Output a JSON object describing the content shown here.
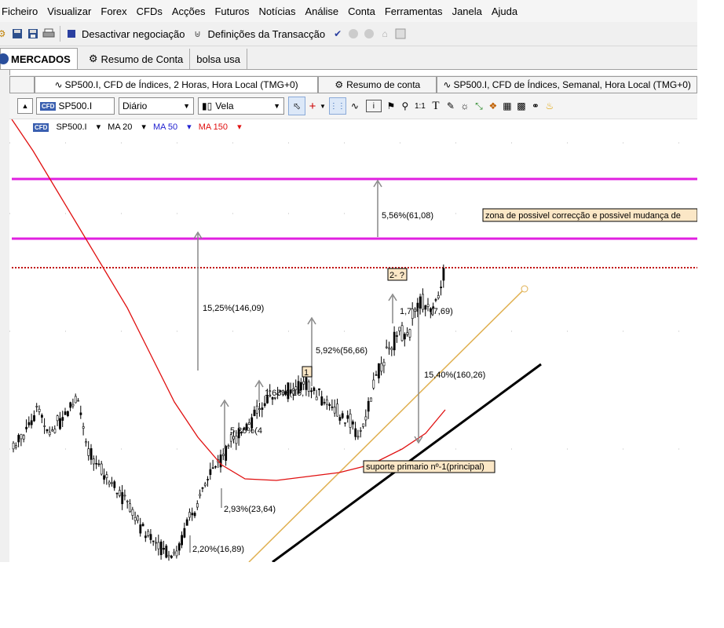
{
  "menu": [
    "Ficheiro",
    "Visualizar",
    "Forex",
    "CFDs",
    "Acções",
    "Futuros",
    "Notícias",
    "Análise",
    "Conta",
    "Ferramentas",
    "Janela",
    "Ajuda"
  ],
  "toolbar": {
    "disable_trading": "Desactivar negociação",
    "trade_settings": "Definições da Transacção"
  },
  "main_tabs": [
    "MERCADOS",
    "Resumo de Conta",
    "bolsa usa"
  ],
  "chart_tabs": [
    "SP500.I, CFD de Índices, 2 Horas, Hora Local (TMG+0)",
    "Resumo de conta",
    "SP500.I, CFD de Índices, Semanal, Hora Local (TMG+0)"
  ],
  "chart_toolbar": {
    "symbol": "SP500.I",
    "timeframe": "Diário",
    "chart_style": "Vela",
    "cfd_badge": "CFD",
    "one_to_one": "1:1"
  },
  "indicators": {
    "symbol": "SP500.I",
    "ma20": "MA 20",
    "ma50": "MA 50",
    "ma150": "MA 150"
  },
  "colors": {
    "magenta": "#e020e0",
    "ma20": "#1a1a1a",
    "ma50": "#2020d0",
    "ma150": "#e01010",
    "trend_orange": "#e0b050",
    "support": "#000000",
    "label_bg": "#fbe7c6",
    "dotted_red": "#c01010"
  },
  "annotations": {
    "zone_label": "zona de possivel correcção e possivel mudança de",
    "support_label": "suporte primario nº-1(principal)",
    "wave1": "1",
    "wave2": "2- ?",
    "m_556": "5,56%(61,08)",
    "m_1525": "15,25%(146,09)",
    "m_592": "5,92%(56,66)",
    "m_168": "1,68%(16,",
    "m_526": "5,26%(4",
    "m_293": "2,93%(23,64)",
    "m_220": "2,20%(16,89)",
    "m_1540": "15,40%(160,26)",
    "m_top": "1,7",
    "m_top2": "(7,69)"
  }
}
